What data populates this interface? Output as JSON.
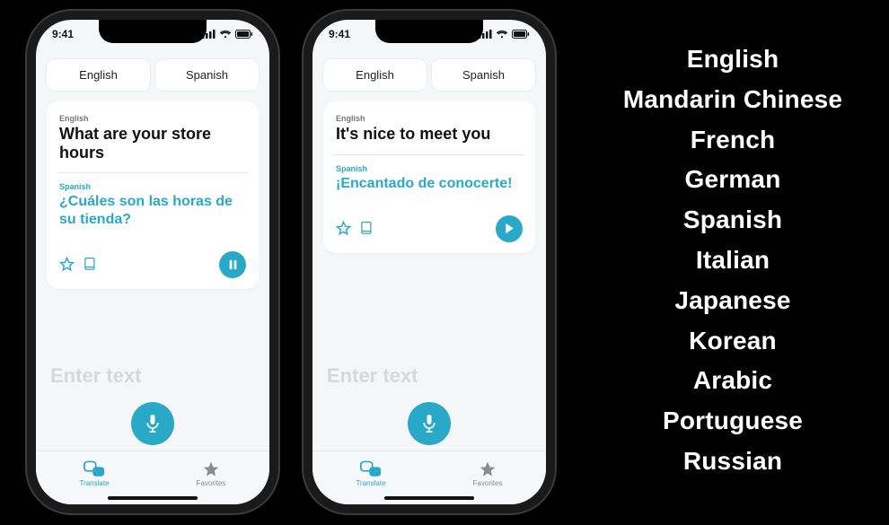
{
  "status": {
    "time": "9:41"
  },
  "phones": [
    {
      "langA": "English",
      "langB": "Spanish",
      "srcLabel": "English",
      "srcText": "What are your store hours",
      "tgtLabel": "Spanish",
      "tgtText": "¿Cuáles son las horas de su tienda?",
      "audioState": "pause",
      "inputPlaceholder": "Enter text",
      "tabs": {
        "translate": "Translate",
        "favorites": "Favorites"
      }
    },
    {
      "langA": "English",
      "langB": "Spanish",
      "srcLabel": "English",
      "srcText": "It's nice to meet you",
      "tgtLabel": "Spanish",
      "tgtText": "¡Encantado de conocerte!",
      "audioState": "play",
      "inputPlaceholder": "Enter text",
      "tabs": {
        "translate": "Translate",
        "favorites": "Favorites"
      }
    }
  ],
  "languages": [
    "English",
    "Mandarin Chinese",
    "French",
    "German",
    "Spanish",
    "Italian",
    "Japanese",
    "Korean",
    "Arabic",
    "Portuguese",
    "Russian"
  ],
  "colors": {
    "accent": "#2aa8c7"
  }
}
